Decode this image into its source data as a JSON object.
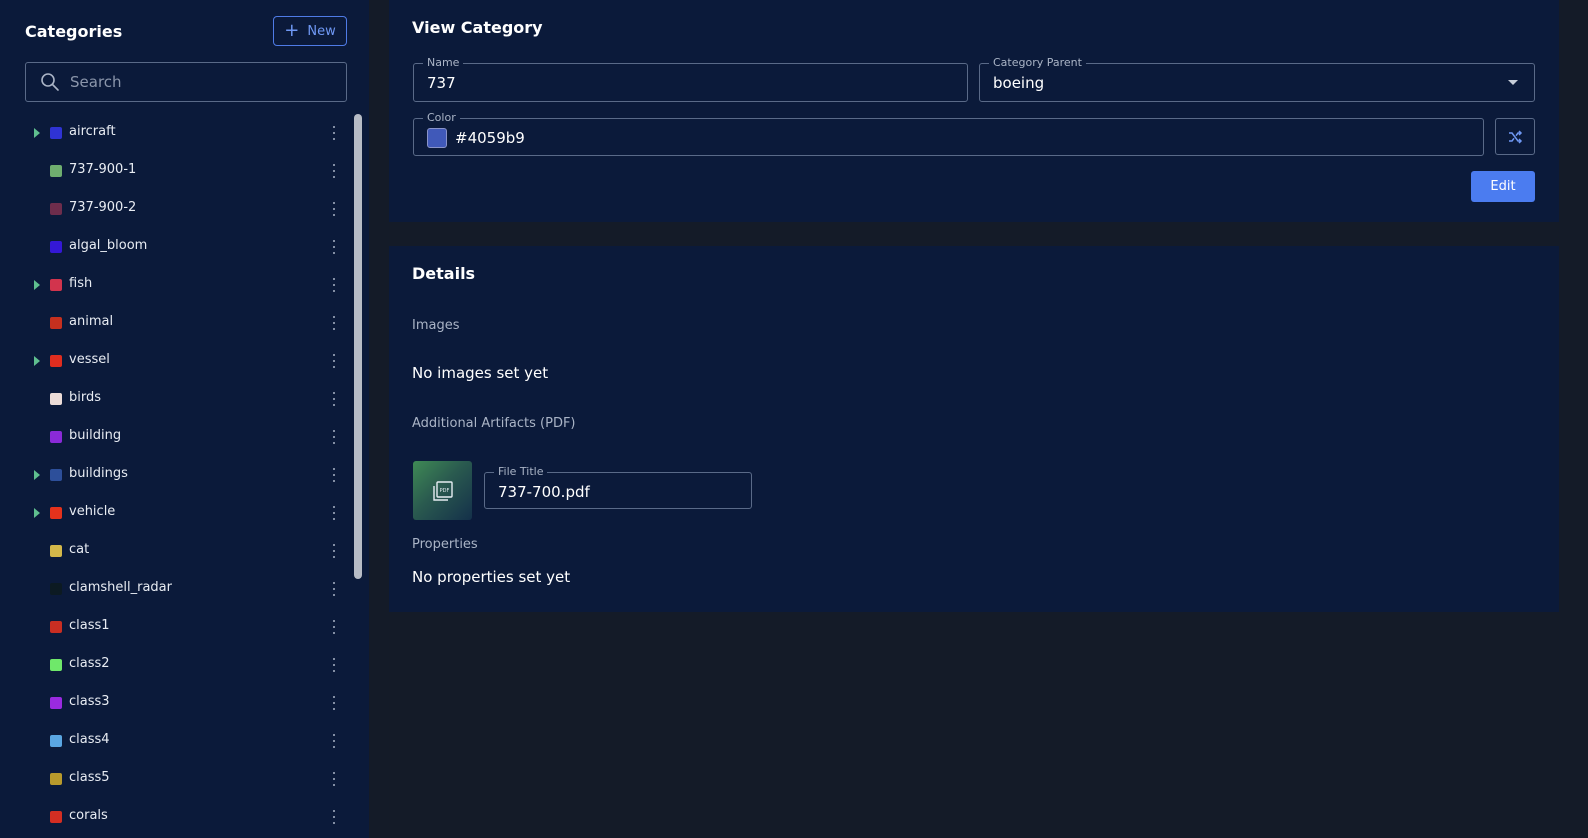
{
  "sidebar": {
    "title": "Categories",
    "new_button": "New",
    "search_placeholder": "Search",
    "items": [
      {
        "label": "aircraft",
        "color": "#2f33d4",
        "expandable": true
      },
      {
        "label": "737-900-1",
        "color": "#6fae6f",
        "expandable": false
      },
      {
        "label": "737-900-2",
        "color": "#6e2d4c",
        "expandable": false
      },
      {
        "label": "algal_bloom",
        "color": "#3418d6",
        "expandable": false
      },
      {
        "label": "fish",
        "color": "#d2344d",
        "expandable": true
      },
      {
        "label": "animal",
        "color": "#c6301f",
        "expandable": false
      },
      {
        "label": "vessel",
        "color": "#e02d1f",
        "expandable": true
      },
      {
        "label": "birds",
        "color": "#ecdcd8",
        "expandable": false
      },
      {
        "label": "building",
        "color": "#8a2ad8",
        "expandable": false
      },
      {
        "label": "buildings",
        "color": "#2d4f9a",
        "expandable": true
      },
      {
        "label": "vehicle",
        "color": "#e5321c",
        "expandable": true
      },
      {
        "label": "cat",
        "color": "#d4b84a",
        "expandable": false
      },
      {
        "label": "clamshell_radar",
        "color": "#0c1a22",
        "expandable": false
      },
      {
        "label": "class1",
        "color": "#c92e22",
        "expandable": false
      },
      {
        "label": "class2",
        "color": "#6fe86a",
        "expandable": false
      },
      {
        "label": "class3",
        "color": "#9a2ae0",
        "expandable": false
      },
      {
        "label": "class4",
        "color": "#5aa6e2",
        "expandable": false
      },
      {
        "label": "class5",
        "color": "#b89a2c",
        "expandable": false
      },
      {
        "label": "corals",
        "color": "#d42e22",
        "expandable": false
      }
    ]
  },
  "view": {
    "title": "View Category",
    "name_label": "Name",
    "name_value": "737",
    "parent_label": "Category Parent",
    "parent_value": "boeing",
    "color_label": "Color",
    "color_value": "#4059b9",
    "edit_button": "Edit"
  },
  "details": {
    "title": "Details",
    "images_label": "Images",
    "images_empty": "No images set yet",
    "artifacts_label": "Additional Artifacts (PDF)",
    "file_title_label": "File Title",
    "file_title_value": "737-700.pdf",
    "properties_label": "Properties",
    "properties_empty": "No properties set yet"
  }
}
